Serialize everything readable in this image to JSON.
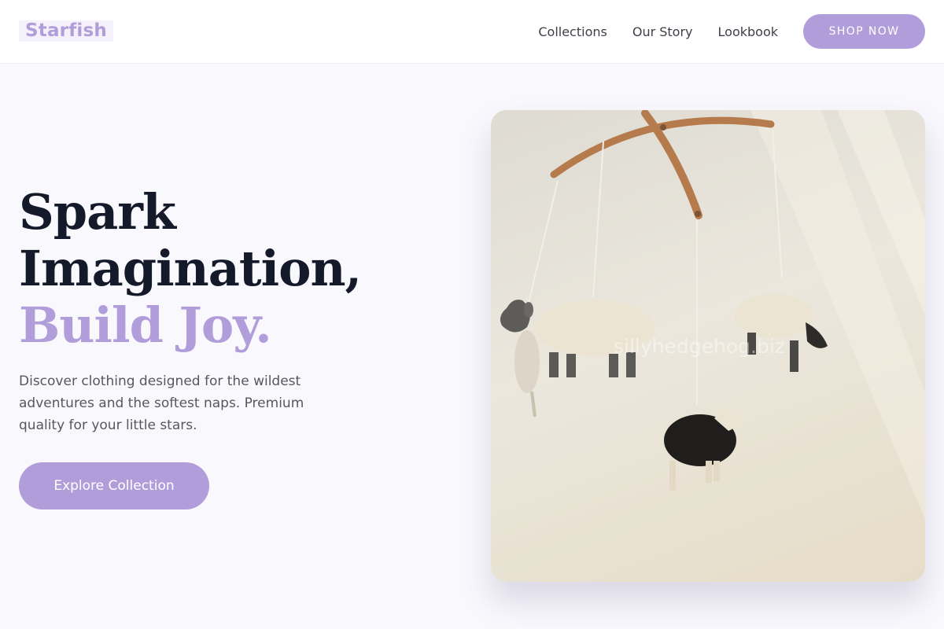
{
  "header": {
    "logo": "Starfish",
    "nav": [
      {
        "label": "Collections"
      },
      {
        "label": "Our Story"
      },
      {
        "label": "Lookbook"
      }
    ],
    "cta_label": "SHOP NOW"
  },
  "hero": {
    "title_line1": "Spark",
    "title_line2": "Imagination,",
    "title_accent": "Build Joy.",
    "description": "Discover clothing designed for the wildest adventures and the softest naps. Premium quality for your little stars.",
    "cta_label": "Explore Collection",
    "image": {
      "subject": "nursery mobile with felt sheep",
      "watermark": "sillyhedgehog.biz"
    }
  },
  "colors": {
    "accent": "#b29ddb",
    "heading": "#151a2b",
    "body_text": "#55585f",
    "background": "#f9f8fd"
  }
}
